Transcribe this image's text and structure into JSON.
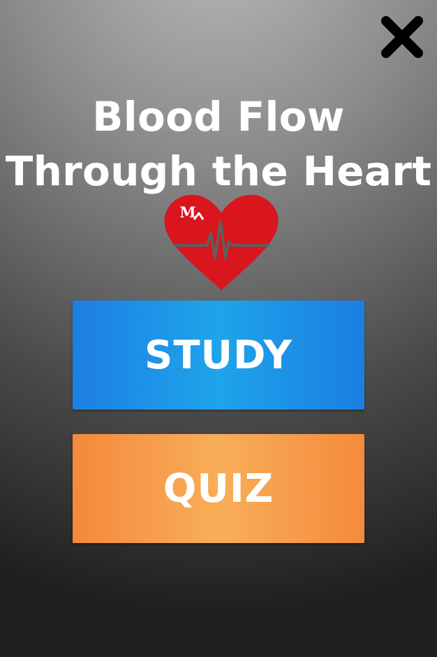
{
  "close_button": {
    "icon": "close-icon"
  },
  "title": {
    "line1": "Blood Flow",
    "line2": "Through the Heart"
  },
  "logo": {
    "icon": "heart-heartbeat-logo-icon",
    "text": "M",
    "heart_color": "#d9151e",
    "pulse_color": "#5f5f5f"
  },
  "buttons": {
    "study_label": "STUDY",
    "quiz_label": "QUIZ"
  },
  "colors": {
    "study_blue": "#1ea4ea",
    "quiz_orange": "#f8ae58",
    "text_white": "#ffffff"
  }
}
